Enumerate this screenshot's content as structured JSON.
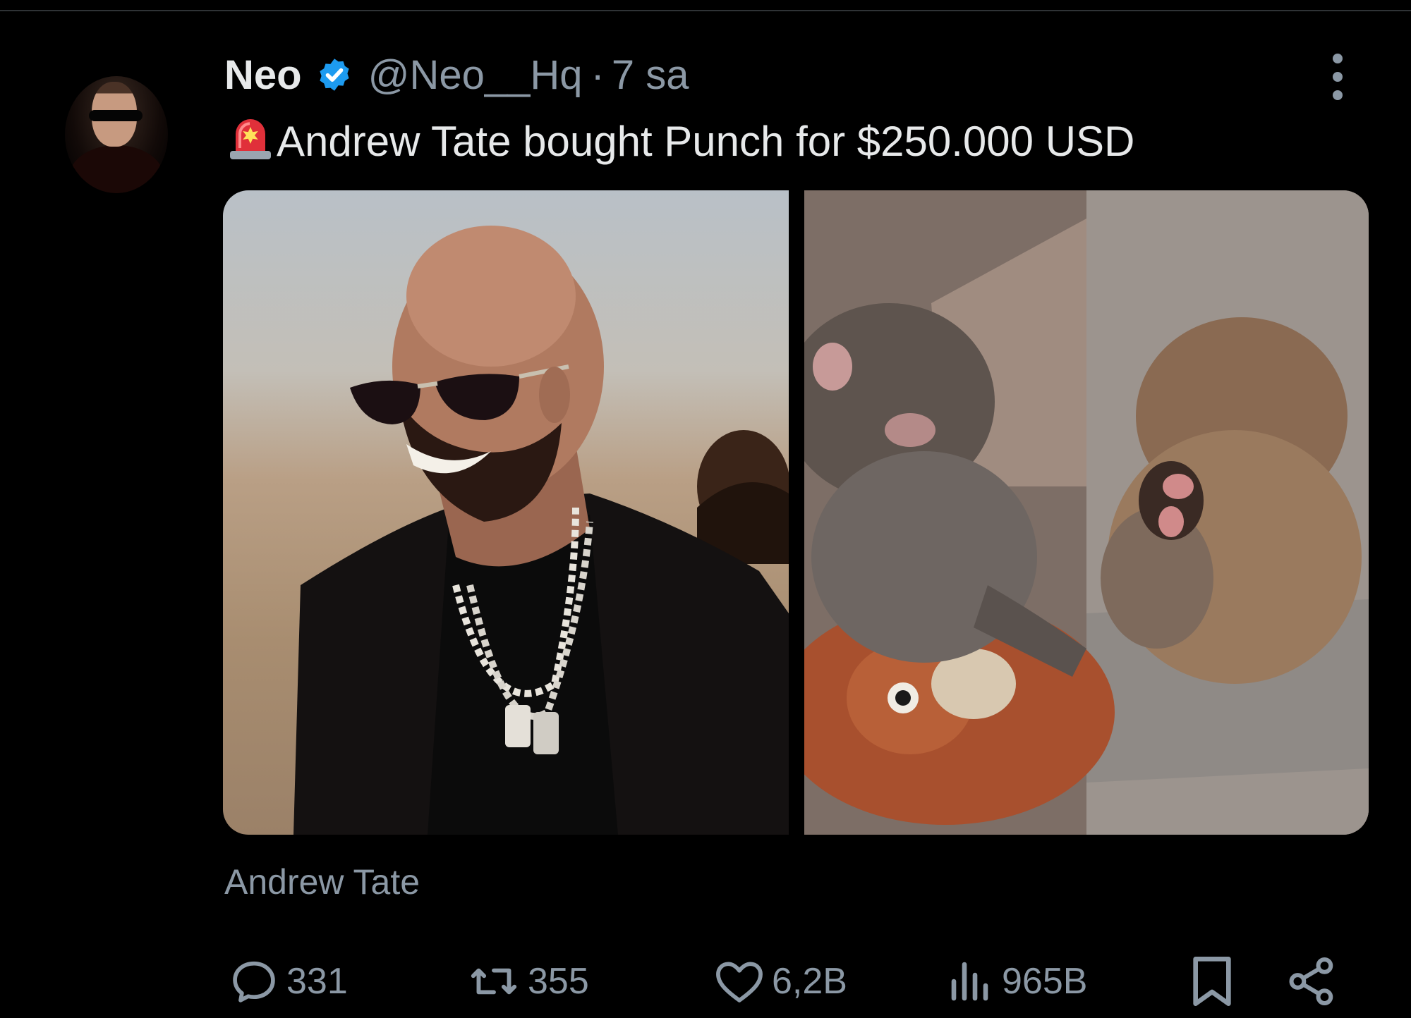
{
  "author": {
    "name": "Neo",
    "handle": "@Neo__Hq",
    "separator": "·",
    "time": "7 sa",
    "verified": true
  },
  "tweet": {
    "emoji": "siren-icon",
    "text": "Andrew Tate bought Punch for $250.000 USD"
  },
  "media": {
    "left_image": "man-in-sunglasses-photo",
    "right_image": "baby-monkey-with-plush-toy-photo"
  },
  "caption": "Andrew Tate",
  "actions": {
    "replies": "331",
    "reposts": "355",
    "likes": "6,2B",
    "views": "965B"
  },
  "colors": {
    "background": "#000000",
    "text": "#e7e9ea",
    "secondary": "#8b98a5",
    "verified": "#1d9bf0"
  }
}
